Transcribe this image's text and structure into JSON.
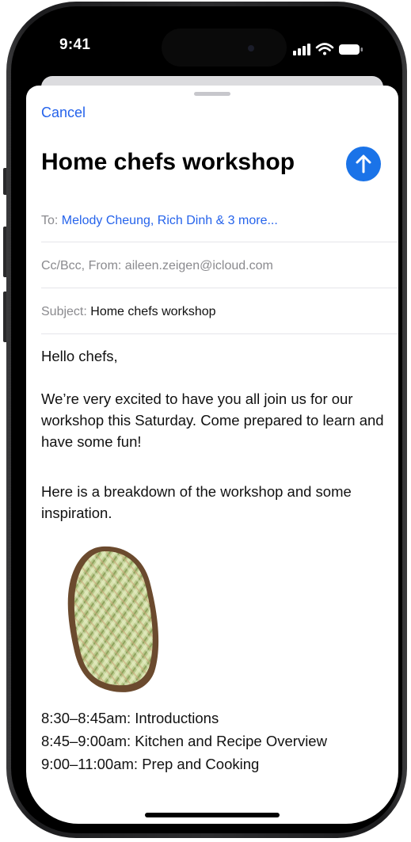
{
  "status_bar": {
    "time": "9:41"
  },
  "compose": {
    "cancel_label": "Cancel",
    "subject_heading": "Home chefs workshop",
    "send_icon": "arrow-up-icon",
    "to_label": "To:",
    "to_recipients": "Melody Cheung, Rich Dinh & 3 more...",
    "ccbcc_from_label": "Cc/Bcc, From:",
    "from_address": "aileen.zeigen@icloud.com",
    "subject_label": "Subject:",
    "subject_value": "Home chefs workshop"
  },
  "body": {
    "greeting": "Hello chefs,",
    "paragraph1": "We’re very excited to have you all join us for our workshop this Saturday. Come prepared to learn and have some fun!",
    "paragraph2": "Here is a breakdown of the workshop and some inspiration.",
    "image": "avocado-toast-image",
    "schedule": [
      "8:30–8:45am: Introductions",
      "8:45–9:00am: Kitchen and Recipe Overview",
      "9:00–11:00am: Prep and Cooking"
    ]
  },
  "colors": {
    "accent": "#2563eb",
    "send_button": "#1a73e8",
    "secondary_text": "#8a8a8e"
  }
}
